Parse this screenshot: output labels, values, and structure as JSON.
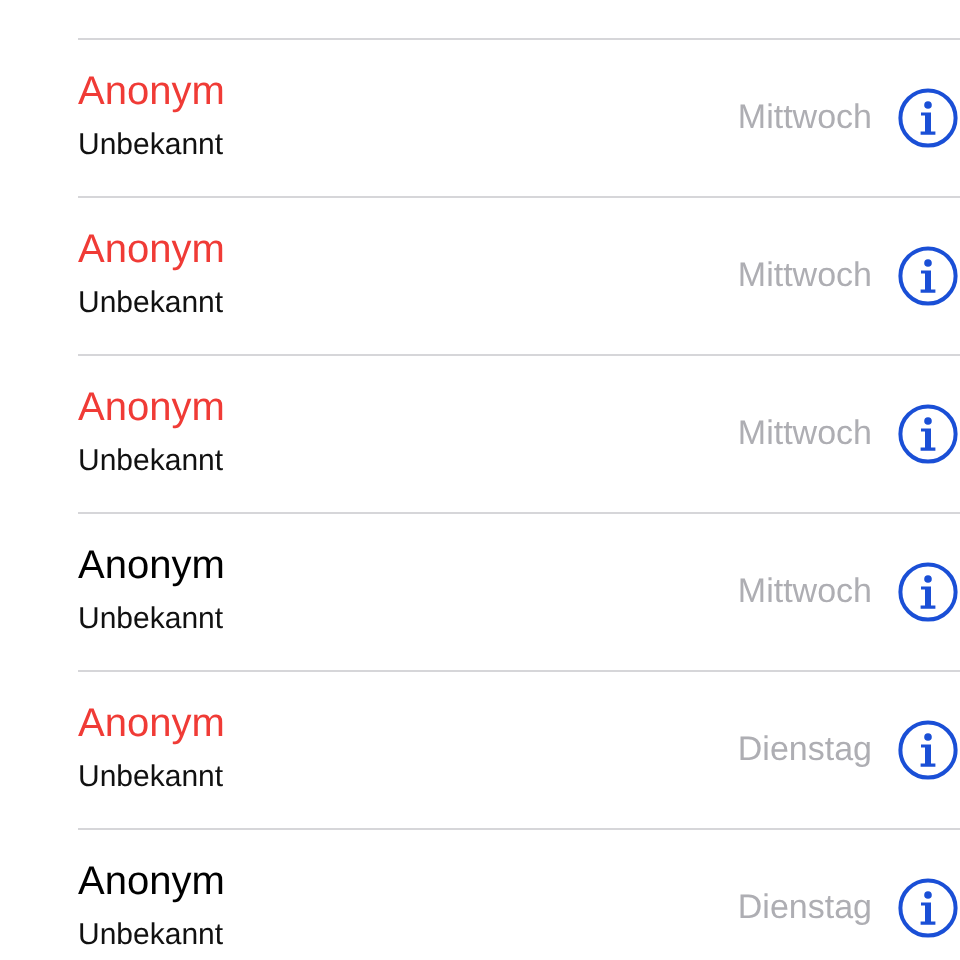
{
  "calls": [
    {
      "name": "Anonym",
      "label": "Unbekannt",
      "day": "Mittwoch",
      "missed": true
    },
    {
      "name": "Anonym",
      "label": "Unbekannt",
      "day": "Mittwoch",
      "missed": true
    },
    {
      "name": "Anonym",
      "label": "Unbekannt",
      "day": "Mittwoch",
      "missed": true
    },
    {
      "name": "Anonym",
      "label": "Unbekannt",
      "day": "Mittwoch",
      "missed": false
    },
    {
      "name": "Anonym",
      "label": "Unbekannt",
      "day": "Dienstag",
      "missed": true
    },
    {
      "name": "Anonym",
      "label": "Unbekannt",
      "day": "Dienstag",
      "missed": false
    }
  ]
}
